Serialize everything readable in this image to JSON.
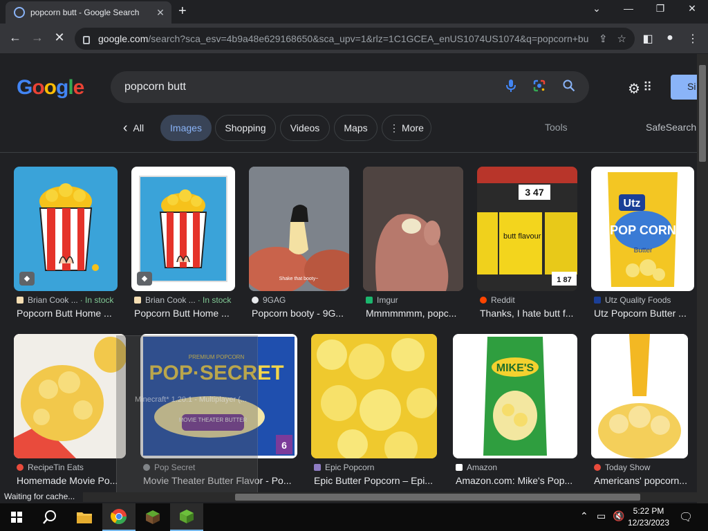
{
  "browser": {
    "tab_title": "popcorn butt - Google Search",
    "url_host": "google.com",
    "url_rest": "/search?sca_esv=4b9a48e629168650&sca_upv=1&rlz=1C1GCEA_enUS1074US1074&q=popcorn+bu...",
    "status_text": "Waiting for cache..."
  },
  "google": {
    "logo_letters": [
      "G",
      "o",
      "o",
      "g",
      "l",
      "e"
    ],
    "query": "popcorn butt",
    "signin_label": "Si",
    "colors": {
      "active_chip_bg": "#394457",
      "accent": "#8ab4f8",
      "in_stock": "#81c995"
    }
  },
  "filters": {
    "back_arrow": "‹",
    "items": [
      {
        "label": "All",
        "active": false
      },
      {
        "label": "Images",
        "active": true
      },
      {
        "label": "Shopping",
        "active": false
      },
      {
        "label": "Videos",
        "active": false
      },
      {
        "label": "Maps",
        "active": false
      },
      {
        "label": "More",
        "active": false
      }
    ],
    "tools_label": "Tools",
    "safesearch_label": "SafeSearch"
  },
  "results_row1": [
    {
      "source": "Brian Cook ...",
      "badge": "· In stock",
      "title": "Popcorn Butt Home ..."
    },
    {
      "source": "Brian Cook ...",
      "badge": "· In stock",
      "title": "Popcorn Butt Home ..."
    },
    {
      "source": "9GAG",
      "badge": "",
      "title": "Popcorn booty - 9G..."
    },
    {
      "source": "Imgur",
      "badge": "",
      "title": "Mmmmmmm, popc..."
    },
    {
      "source": "Reddit",
      "badge": "",
      "title": "Thanks, I hate butt f..."
    },
    {
      "source": "Utz Quality Foods",
      "badge": "",
      "title": "Utz Popcorn Butter ..."
    }
  ],
  "results_row2": [
    {
      "source": "RecipeTin Eats",
      "title": "Homemade Movie Po..."
    },
    {
      "source": "Pop Secret",
      "title": "Movie Theater Butter Flavor - Po..."
    },
    {
      "source": "Epic Popcorn",
      "title": "Epic Butter Popcorn – Epi..."
    },
    {
      "source": "Amazon",
      "title": "Amazon.com: Mike's Pop..."
    },
    {
      "source": "Today Show",
      "title": "Americans' popcorn..."
    }
  ],
  "image_text": {
    "price_tag": "3 47",
    "price_tag2": "1 87",
    "butt_flavour": "butt flavour",
    "utz": "Utz",
    "pop_corn": "POP CORN",
    "butter": "Butter",
    "shake": "Shake that booty~",
    "pop_secret": "POP·SECRET",
    "premium": "PREMIUM POPCORN",
    "movie_theater": "MOVIE THEATER BUTTER",
    "mikes": "MIKE'S",
    "six": "6"
  },
  "ghost_window": {
    "title": "Minecraft* 1.20.1 - Multiplayer (..."
  },
  "taskbar": {
    "time": "5:22 PM",
    "date": "12/23/2023"
  }
}
